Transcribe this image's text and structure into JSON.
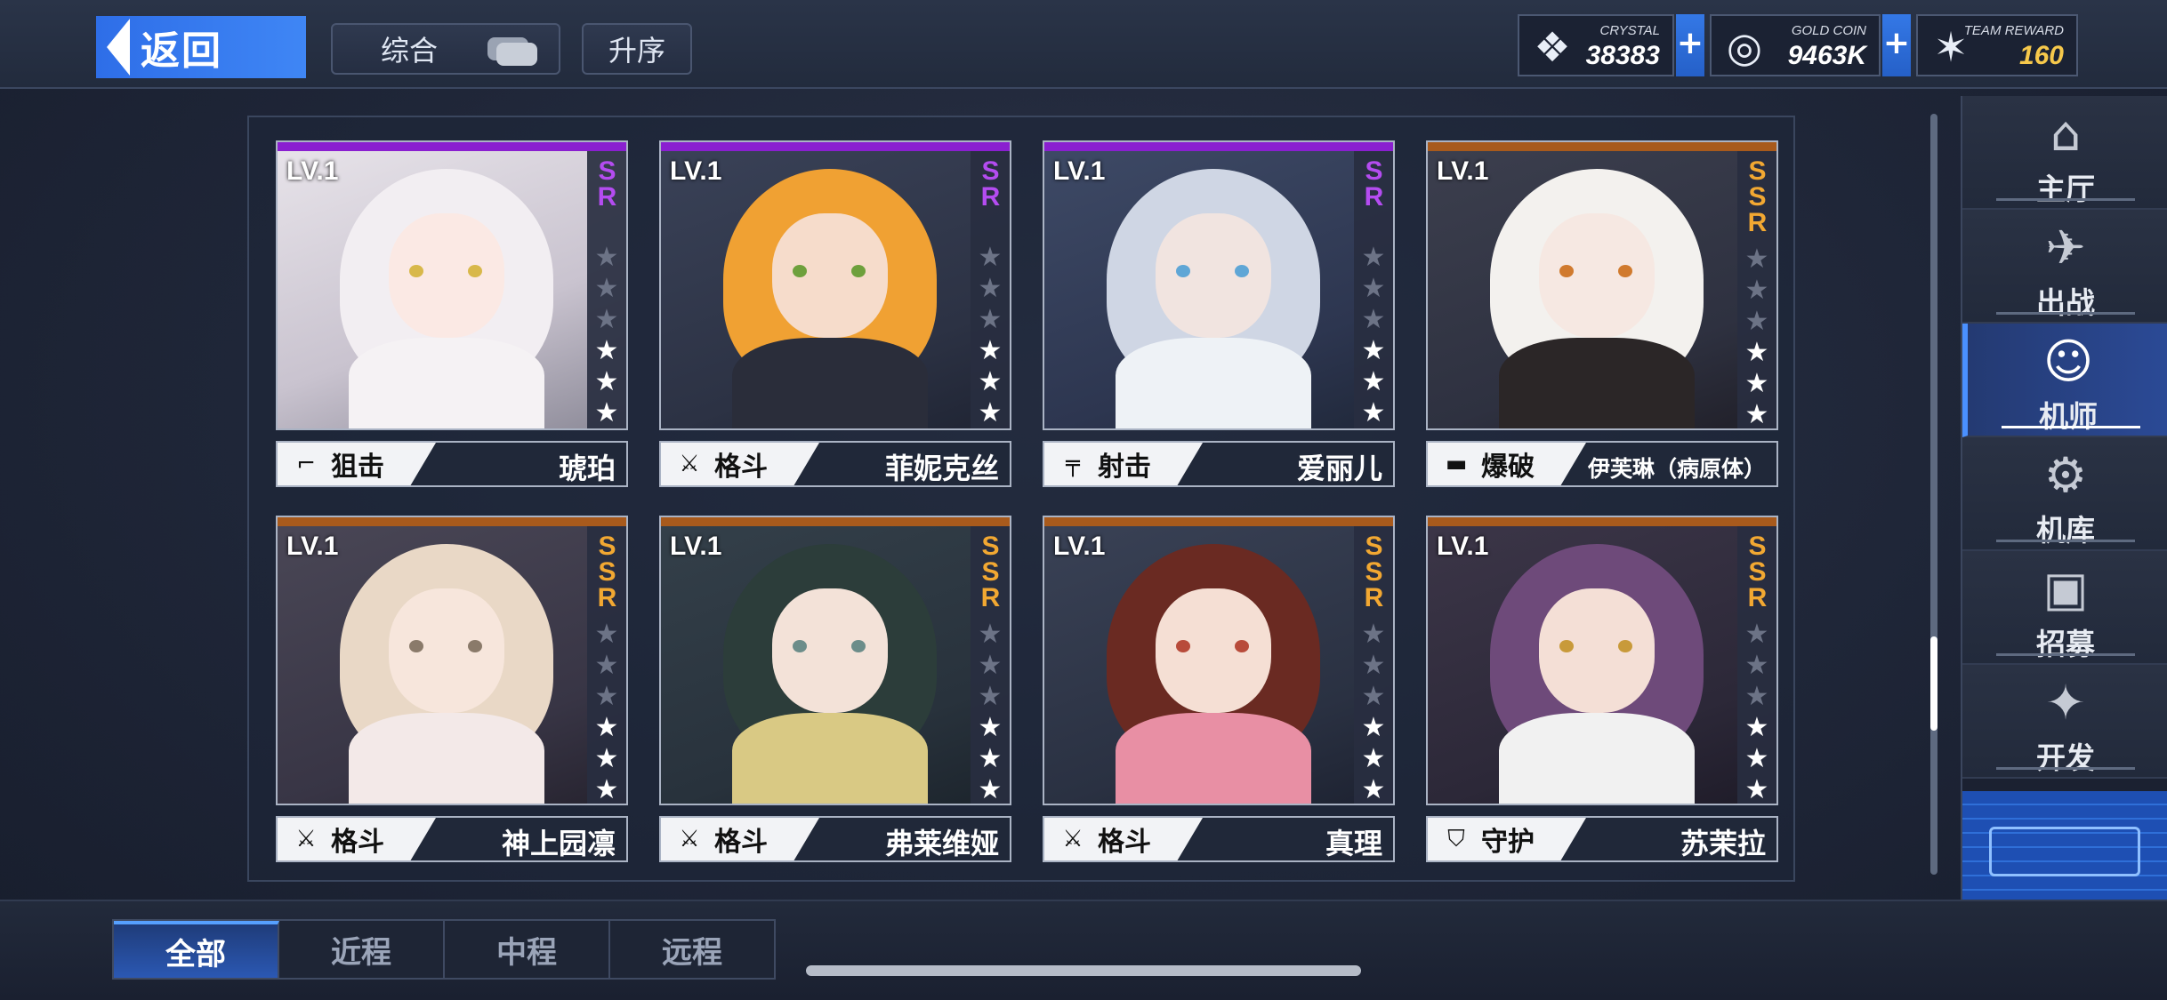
{
  "header": {
    "back_label": "返回",
    "filter_label": "综合",
    "order_label": "升序"
  },
  "resources": {
    "crystal": {
      "caption": "CRYSTAL",
      "value": "38383"
    },
    "gold": {
      "caption": "GOLD COIN",
      "value": "9463K"
    },
    "team_reward": {
      "caption": "TEAM REWARD",
      "value": "160"
    },
    "plus_symbol": "+"
  },
  "pilots": [
    {
      "level": "LV.1",
      "rarity": "SR",
      "stars": 3,
      "max_stars": 6,
      "role": "狙击",
      "role_icon": "sniper-rifle-icon",
      "name": "琥珀"
    },
    {
      "level": "LV.1",
      "rarity": "SR",
      "stars": 3,
      "max_stars": 6,
      "role": "格斗",
      "role_icon": "crossed-swords-icon",
      "name": "菲妮克丝"
    },
    {
      "level": "LV.1",
      "rarity": "SR",
      "stars": 3,
      "max_stars": 6,
      "role": "射击",
      "role_icon": "rifle-icon",
      "name": "爱丽儿"
    },
    {
      "level": "LV.1",
      "rarity": "SSR",
      "stars": 3,
      "max_stars": 6,
      "role": "爆破",
      "role_icon": "launcher-icon",
      "name": "伊芙琳（病原体）"
    },
    {
      "level": "LV.1",
      "rarity": "SSR",
      "stars": 3,
      "max_stars": 6,
      "role": "格斗",
      "role_icon": "crossed-swords-icon",
      "name": "神上园凛"
    },
    {
      "level": "LV.1",
      "rarity": "SSR",
      "stars": 3,
      "max_stars": 6,
      "role": "格斗",
      "role_icon": "crossed-swords-icon",
      "name": "弗莱维娅"
    },
    {
      "level": "LV.1",
      "rarity": "SSR",
      "stars": 3,
      "max_stars": 6,
      "role": "格斗",
      "role_icon": "crossed-swords-icon",
      "name": "真理"
    },
    {
      "level": "LV.1",
      "rarity": "SSR",
      "stars": 3,
      "max_stars": 6,
      "role": "守护",
      "role_icon": "shield-icon",
      "name": "苏茉拉"
    }
  ],
  "rightnav": {
    "items": [
      {
        "label": "主厅",
        "icon": "lobby-icon"
      },
      {
        "label": "出战",
        "icon": "sortie-icon"
      },
      {
        "label": "机师",
        "icon": "pilot-icon",
        "active": true
      },
      {
        "label": "机库",
        "icon": "hangar-icon"
      },
      {
        "label": "招募",
        "icon": "recruit-icon"
      },
      {
        "label": "开发",
        "icon": "develop-icon"
      }
    ]
  },
  "tabs": [
    {
      "label": "全部",
      "active": true
    },
    {
      "label": "近程"
    },
    {
      "label": "中程"
    },
    {
      "label": "远程"
    }
  ],
  "colors": {
    "sr": "#b44cf0",
    "ssr": "#f2a832",
    "accent_blue": "#3f86f5"
  }
}
